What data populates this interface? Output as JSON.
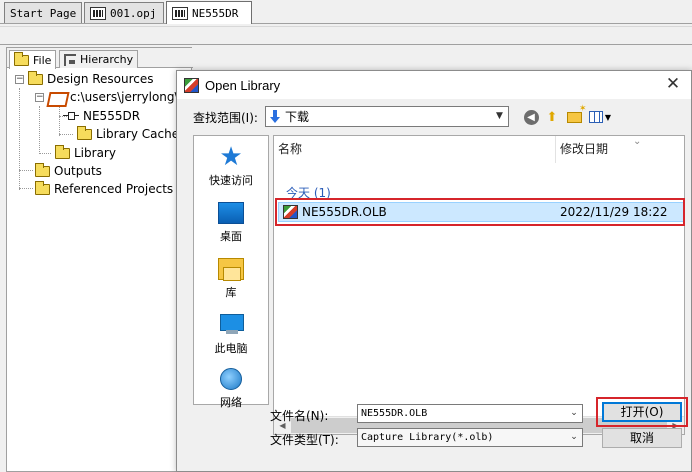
{
  "doc_tabs": [
    {
      "label": "Start Page",
      "active": false
    },
    {
      "label": "001.opj",
      "active": false
    },
    {
      "label": "NE555DR",
      "active": true
    }
  ],
  "project_panel": {
    "tabs": [
      {
        "label": "File",
        "icon": "folder-icon",
        "active": true
      },
      {
        "label": "Hierarchy",
        "icon": "hierarchy-icon",
        "active": false
      }
    ],
    "tree": {
      "design_resources": "Design Resources",
      "library_path": "c:\\users\\jerrylong\\",
      "part": "NE555DR",
      "library_cache": "Library Cache",
      "library": "Library",
      "outputs": "Outputs",
      "referenced_projects": "Referenced Projects"
    }
  },
  "dialog": {
    "title": "Open Library",
    "close_glyph": "✕",
    "look_in_label": "查找范围(I):",
    "look_in_value": "下载",
    "places": [
      {
        "label": "快速访问",
        "icon": "quick-access-star-icon"
      },
      {
        "label": "桌面",
        "icon": "desktop-icon"
      },
      {
        "label": "库",
        "icon": "libraries-icon"
      },
      {
        "label": "此电脑",
        "icon": "this-pc-icon"
      },
      {
        "label": "网络",
        "icon": "network-icon"
      }
    ],
    "columns": {
      "name": "名称",
      "date": "修改日期"
    },
    "group_header": "今天 (1)",
    "files": [
      {
        "name": "NE555DR.OLB",
        "date": "2022/11/29 18:22",
        "selected": true
      }
    ],
    "filename_label": "文件名(N):",
    "filename_value": "NE555DR.OLB",
    "filetype_label": "文件类型(T):",
    "filetype_value": "Capture Library(*.olb)",
    "open_button": "打开(O)",
    "cancel_button": "取消"
  },
  "colors": {
    "highlight_box": "#d6252b",
    "selection": "#cce8ff",
    "group_header_text": "#2a5cb8",
    "default_button_border": "#0078d7"
  }
}
